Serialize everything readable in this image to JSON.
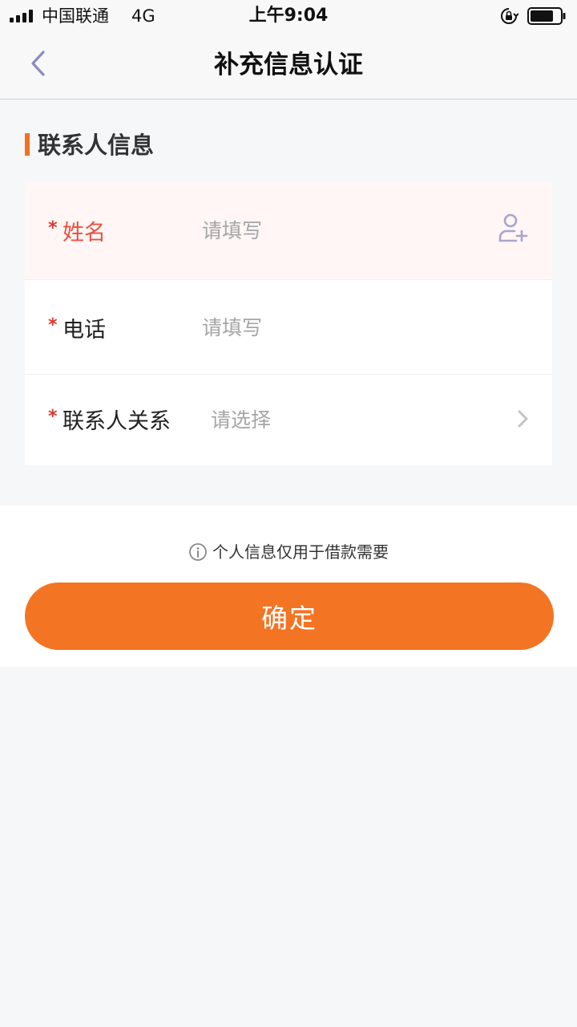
{
  "status_bar": {
    "carrier": "中国联通",
    "network": "4G",
    "time": "上午9:04"
  },
  "nav": {
    "title": "补充信息认证"
  },
  "section": {
    "title": "联系人信息"
  },
  "form": {
    "required_mark": "*",
    "name": {
      "label": "姓名",
      "placeholder": "请填写",
      "value": ""
    },
    "phone": {
      "label": "电话",
      "placeholder": "请填写",
      "value": ""
    },
    "relation": {
      "label": "联系人关系",
      "placeholder": "请选择"
    }
  },
  "notice": {
    "text": "个人信息仅用于借款需要"
  },
  "confirm": {
    "label": "确定"
  },
  "colors": {
    "accent": "#f37423",
    "required": "#e0352b",
    "active_row_bg": "#fff6f5",
    "page_bg": "#f6f7f9"
  },
  "icons": {
    "back": "chevron-left-icon",
    "add_contact": "user-plus-icon",
    "relation_picker": "chevron-right-icon",
    "notice": "info-icon",
    "rotation": "rotation-lock-icon",
    "battery": "battery-icon",
    "signal": "signal-icon"
  }
}
